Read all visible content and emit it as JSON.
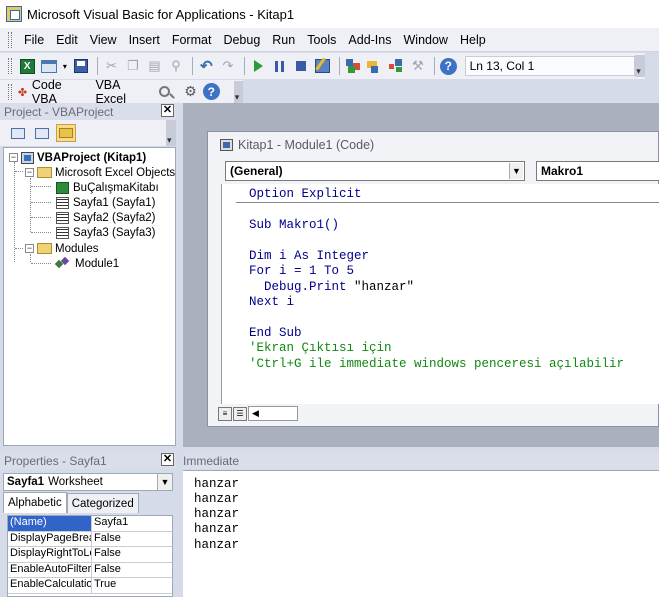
{
  "window": {
    "title": "Microsoft Visual Basic for Applications - Kitap1"
  },
  "menu": [
    "File",
    "Edit",
    "View",
    "Insert",
    "Format",
    "Debug",
    "Run",
    "Tools",
    "Add-Ins",
    "Window",
    "Help"
  ],
  "toolbar": {
    "position_text": "Ln 13, Col 1"
  },
  "toolbar2": {
    "code_vba": "Code VBA",
    "vba_excel": "VBA Excel"
  },
  "project": {
    "header": "Project - VBAProject",
    "tree": {
      "root": "VBAProject (Kitap1)",
      "excel_objects": "Microsoft Excel Objects",
      "items": [
        "BuÇalışmaKitabı",
        "Sayfa1 (Sayfa1)",
        "Sayfa2 (Sayfa2)",
        "Sayfa3 (Sayfa3)"
      ],
      "modules": "Modules",
      "module1": "Module1"
    }
  },
  "properties": {
    "header": "Properties - Sayfa1",
    "object_name": "Sayfa1",
    "object_type": "Worksheet",
    "tabs": [
      "Alphabetic",
      "Categorized"
    ],
    "rows": [
      {
        "name": "(Name)",
        "value": "Sayfa1"
      },
      {
        "name": "DisplayPageBreak",
        "value": "False"
      },
      {
        "name": "DisplayRightToLef",
        "value": "False"
      },
      {
        "name": "EnableAutoFilter",
        "value": "False"
      },
      {
        "name": "EnableCalculation",
        "value": "True"
      }
    ]
  },
  "code_window": {
    "title": "Kitap1 - Module1 (Code)",
    "object_combo": "(General)",
    "proc_combo": "Makro1",
    "lines": {
      "l1": "Option Explicit",
      "l2": "Sub Makro1()",
      "l3": "Dim i As Integer",
      "l4": "For i = 1 To 5",
      "l5_pre": "  Debug.Print ",
      "l5_str": "\"hanzar\"",
      "l6": "Next i",
      "l7": "End Sub",
      "l8": "'Ekran Çıktısı için",
      "l9": "'Ctrl+G ile immediate windows penceresi açılabilir"
    }
  },
  "immediate": {
    "header": "Immediate",
    "lines": [
      "hanzar",
      "hanzar",
      "hanzar",
      "hanzar",
      "hanzar"
    ]
  },
  "colors": {
    "keyword": "#00008b",
    "comment": "#118811",
    "selection": "#3064c8"
  }
}
